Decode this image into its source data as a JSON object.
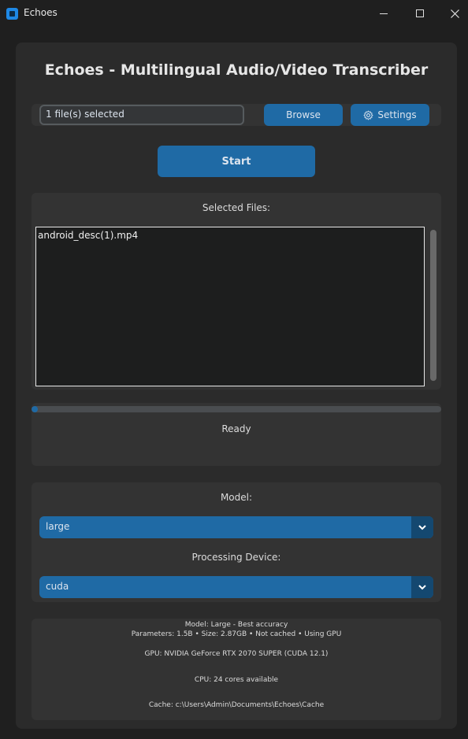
{
  "window": {
    "title": "Echoes",
    "controls": {
      "minimize": "minimize-icon",
      "maximize": "maximize-icon",
      "close": "close-icon"
    }
  },
  "header": {
    "title": "Echoes - Multilingual Audio/Video Transcriber"
  },
  "file_select": {
    "value": "1 file(s) selected",
    "browse_label": "Browse",
    "settings_label": "Settings",
    "settings_icon": "gear-icon"
  },
  "start_label": "Start",
  "selected_files": {
    "label": "Selected Files:",
    "items": [
      "android_desc(1).mp4"
    ]
  },
  "progress": {
    "fraction": 0.015,
    "status": "Ready"
  },
  "options": {
    "model_label": "Model:",
    "model_value": "large",
    "device_label": "Processing Device:",
    "device_value": "cuda"
  },
  "info": {
    "model_line": "Model: Large - Best accuracy",
    "params_line": "Parameters: 1.5B • Size: 2.87GB • Not cached • Using GPU",
    "gpu_line": "GPU: NVIDIA GeForce RTX 2070 SUPER (CUDA 12.1)",
    "cpu_line": "CPU: 24 cores available",
    "cache_line": "Cache: c:\\Users\\Admin\\Documents\\Echoes\\Cache"
  },
  "colors": {
    "accent": "#1f6aa5",
    "accent_dark": "#144870",
    "panel": "#333333",
    "background": "#2b2b2b"
  }
}
